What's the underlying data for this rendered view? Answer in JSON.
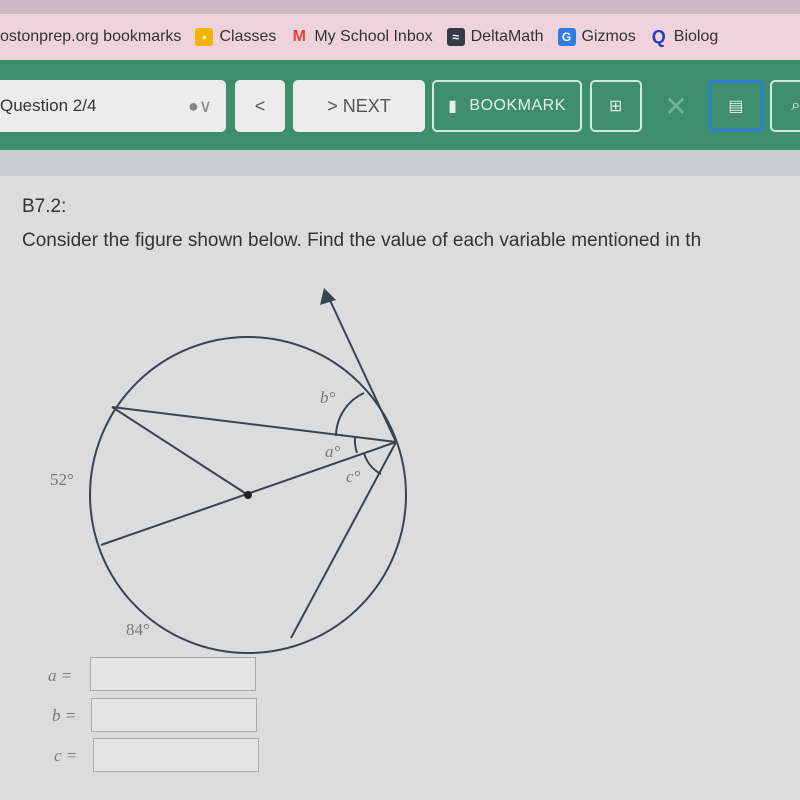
{
  "bookmarks_bar": {
    "items": [
      {
        "label": "ostonprep.org bookmarks",
        "icon": "none"
      },
      {
        "label": "Classes",
        "icon": "classroom-icon",
        "color": "#f2b400"
      },
      {
        "label": "My School Inbox",
        "icon": "gmail-icon",
        "color": "#ea4335"
      },
      {
        "label": "DeltaMath",
        "icon": "deltamath-icon",
        "color": "#333a48"
      },
      {
        "label": "Gizmos",
        "icon": "gizmos-icon",
        "color": "#2f7de1"
      },
      {
        "label": "Biolog",
        "icon": "quizlet-icon",
        "color": "#2a3bb7"
      }
    ]
  },
  "toolbar": {
    "question_label": "Question 2/4",
    "prev_label": "<",
    "next_label": "> NEXT",
    "bookmark_label": "BOOKMARK",
    "accent": "#3e8e6c"
  },
  "question": {
    "id": "B7.2:",
    "prompt": "Consider the figure shown below. Find the value of each variable mentioned in th",
    "figure": {
      "arc_left": "52°",
      "arc_bottom": "84°",
      "angle_a": "a°",
      "angle_b": "b°",
      "angle_c": "c°"
    },
    "answers": [
      {
        "label": "a =",
        "value": ""
      },
      {
        "label": "b =",
        "value": ""
      },
      {
        "label": "c =",
        "value": ""
      }
    ]
  }
}
